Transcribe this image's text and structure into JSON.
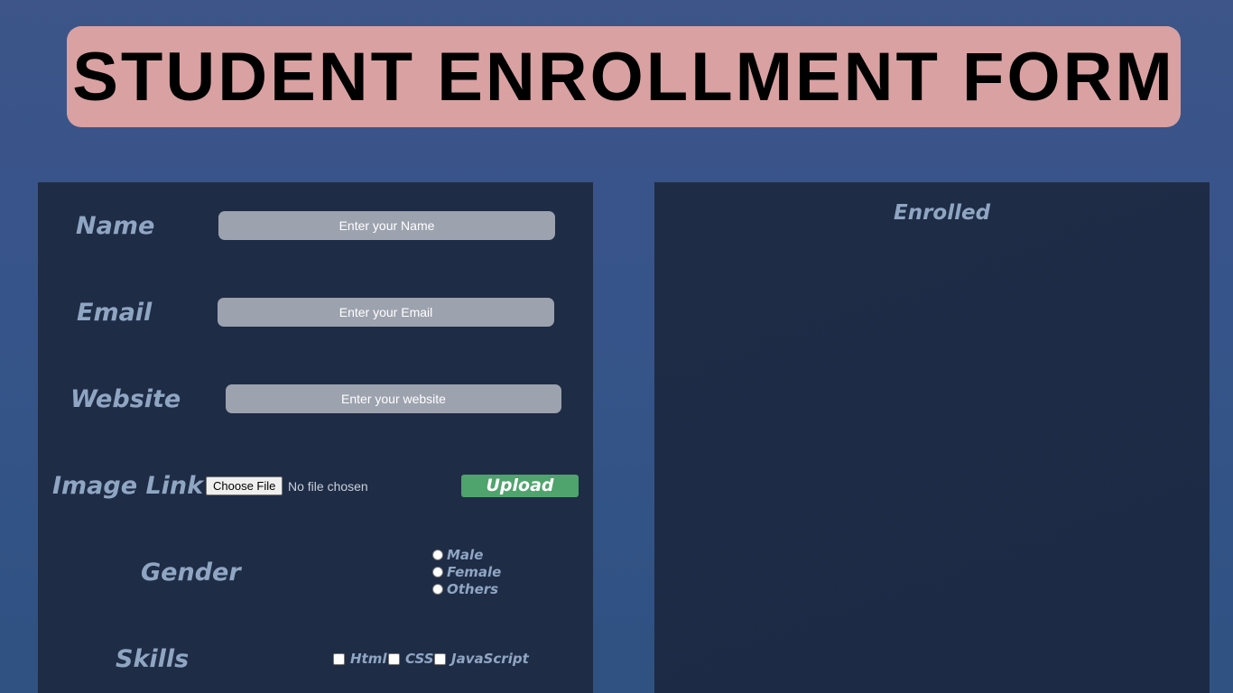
{
  "header": {
    "title": "STUDENT ENROLLMENT FORM"
  },
  "form": {
    "name": {
      "label": "Name",
      "placeholder": "Enter your Name",
      "value": ""
    },
    "email": {
      "label": "Email",
      "placeholder": "Enter your Email",
      "value": ""
    },
    "website": {
      "label": "Website",
      "placeholder": "Enter your website",
      "value": ""
    },
    "image_link": {
      "label": "Image Link",
      "choose_file_label": "Choose File",
      "file_status": "No file chosen",
      "upload_label": "Upload"
    },
    "gender": {
      "label": "Gender",
      "options": [
        "Male",
        "Female",
        "Others"
      ],
      "selected": null
    },
    "skills": {
      "label": "Skills",
      "options": [
        "Html",
        "CSS",
        "JavaScript"
      ],
      "checked": [
        false,
        false,
        false
      ]
    }
  },
  "enrolled": {
    "title": "Enrolled",
    "students": []
  },
  "colors": {
    "title_box": "#d9a1a2",
    "panel": "#1f2c46",
    "label": "#8fa6c3",
    "input": "#9ca2ae",
    "upload": "#4fa36c"
  }
}
